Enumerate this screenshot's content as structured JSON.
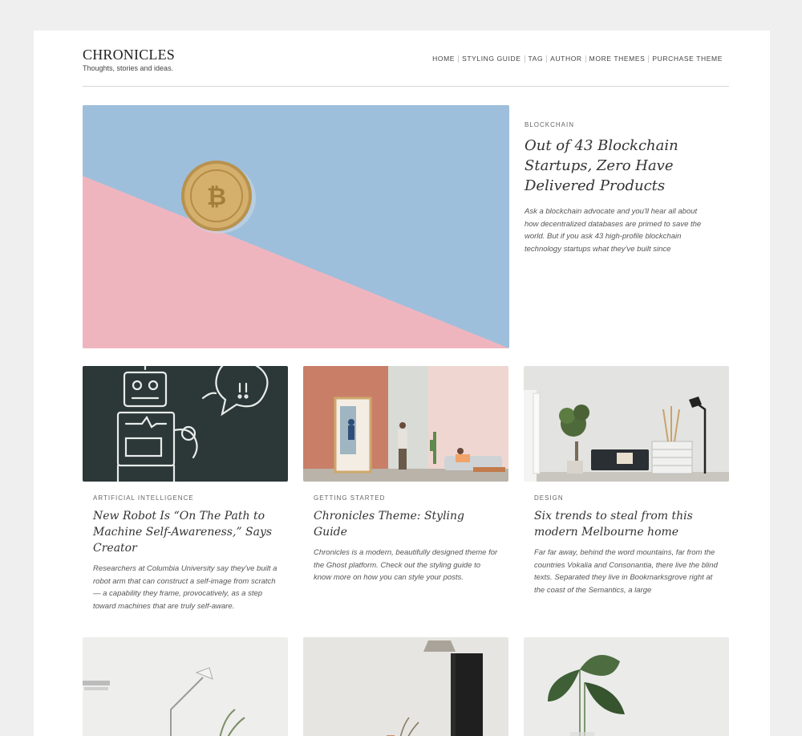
{
  "brand": {
    "name": "CHRONICLES",
    "tagline": "Thoughts, stories and ideas."
  },
  "nav": [
    "HOME",
    "STYLING GUIDE",
    "TAG",
    "AUTHOR",
    "MORE THEMES",
    "PURCHASE THEME"
  ],
  "featured": {
    "category": "BLOCKCHAIN",
    "title": "Out of 43 Blockchain Startups, Zero Have Delivered Products",
    "excerpt": "Ask a blockchain advocate and you'll hear all about how decentralized databases are primed to save the world. But if you ask 43 high-profile blockchain technology startups what they've built since"
  },
  "posts": [
    {
      "category": "ARTIFICIAL INTELLIGENCE",
      "title": "New Robot Is “On The Path to Machine Self-Awareness,” Says Creator",
      "excerpt": "Researchers at Columbia University say they've built a robot arm that can construct a self-image from scratch — a capability they frame, provocatively, as a step toward machines that are truly self-aware."
    },
    {
      "category": "GETTING STARTED",
      "title": "Chronicles Theme: Styling Guide",
      "excerpt": "Chronicles is a modern, beautifully designed theme for the Ghost platform. Check out the styling guide to know more on how you can style your posts."
    },
    {
      "category": "DESIGN",
      "title": "Six trends to steal from this modern Melbourne home",
      "excerpt": "Far far away, behind the word mountains, far from the countries Vokalia and Consonantia, there live the blind texts. Separated they live in Bookmarksgrove right at the coast of the Semantics, a large"
    }
  ]
}
